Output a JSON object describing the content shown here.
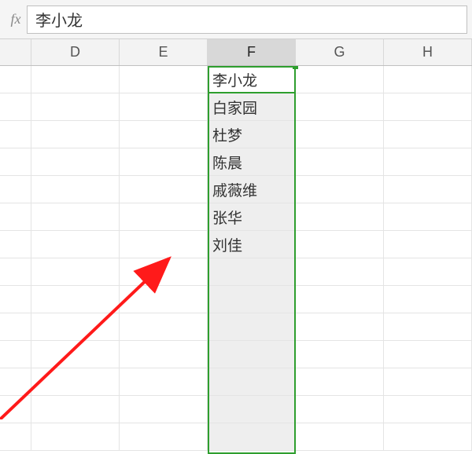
{
  "formula_bar": {
    "fx_label": "fx",
    "value": "李小龙"
  },
  "columns": [
    "",
    "D",
    "E",
    "F",
    "G",
    "H"
  ],
  "selected_column_index": 3,
  "cells_f": [
    "李小龙",
    "白家园",
    "杜梦",
    "陈晨",
    "戚薇维",
    "张华",
    "刘佳",
    "",
    "",
    "",
    "",
    "",
    "",
    ""
  ],
  "row_count": 14
}
